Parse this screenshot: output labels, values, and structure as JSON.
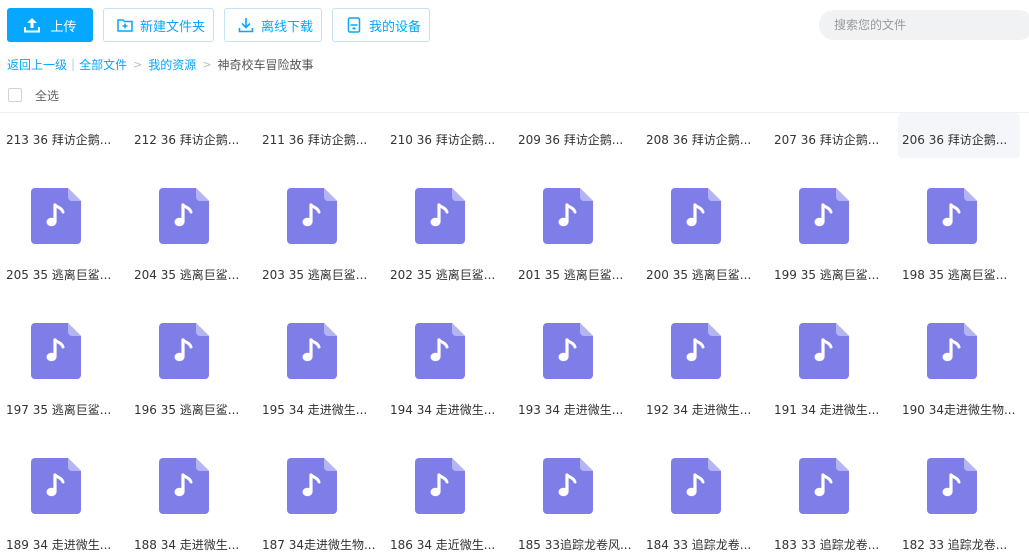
{
  "toolbar": {
    "upload_label": "上传",
    "new_folder_label": "新建文件夹",
    "offline_download_label": "离线下载",
    "my_devices_label": "我的设备"
  },
  "search": {
    "placeholder": "搜索您的文件"
  },
  "breadcrumb": {
    "back": "返回上一级",
    "all_files": "全部文件",
    "my_resources": "我的资源",
    "current": "神奇校车冒险故事"
  },
  "select_all_label": "全选",
  "colors": {
    "accent": "#06a7ff",
    "audio_icon": "#7f7ee8"
  },
  "files": [
    {
      "name": "213 36 拜访企鹅..."
    },
    {
      "name": "212 36 拜访企鹅..."
    },
    {
      "name": "211 36 拜访企鹅..."
    },
    {
      "name": "210 36 拜访企鹅..."
    },
    {
      "name": "209 36 拜访企鹅..."
    },
    {
      "name": "208 36 拜访企鹅..."
    },
    {
      "name": "207 36 拜访企鹅..."
    },
    {
      "name": "206 36 拜访企鹅..."
    },
    {
      "name": "205 35 逃离巨鲨..."
    },
    {
      "name": "204 35 逃离巨鲨..."
    },
    {
      "name": "203 35 逃离巨鲨..."
    },
    {
      "name": "202 35 逃离巨鲨..."
    },
    {
      "name": "201 35 逃离巨鲨..."
    },
    {
      "name": "200 35 逃离巨鲨..."
    },
    {
      "name": "199 35 逃离巨鲨..."
    },
    {
      "name": "198 35 逃离巨鲨..."
    },
    {
      "name": "197 35 逃离巨鲨..."
    },
    {
      "name": "196 35 逃离巨鲨..."
    },
    {
      "name": "195 34 走进微生..."
    },
    {
      "name": "194 34 走进微生..."
    },
    {
      "name": "193 34 走进微生..."
    },
    {
      "name": "192 34 走进微生..."
    },
    {
      "name": "191 34 走进微生..."
    },
    {
      "name": "190 34走进微生物..."
    },
    {
      "name": "189 34 走进微生..."
    },
    {
      "name": "188 34 走进微生..."
    },
    {
      "name": "187 34走进微生物..."
    },
    {
      "name": "186 34 走近微生..."
    },
    {
      "name": "185 33追踪龙卷风..."
    },
    {
      "name": "184 33 追踪龙卷..."
    },
    {
      "name": "183 33 追踪龙卷..."
    },
    {
      "name": "182 33 追踪龙卷..."
    }
  ]
}
